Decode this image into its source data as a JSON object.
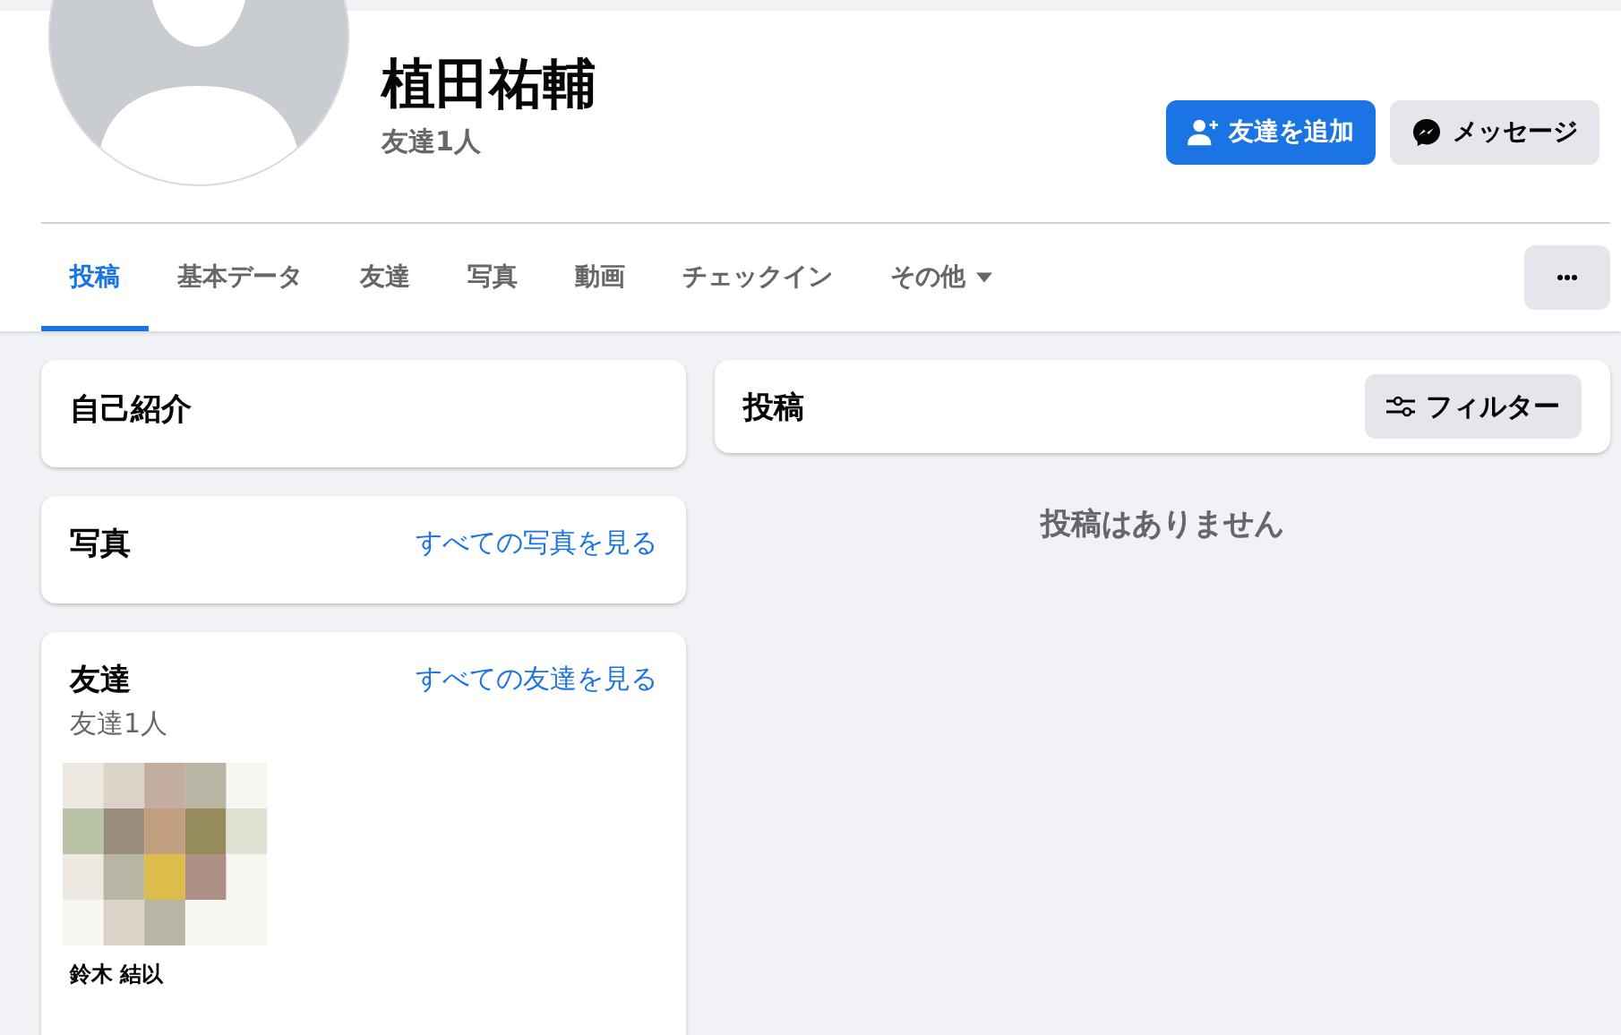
{
  "profile": {
    "name": "植田祐輔",
    "friend_count": "友達1人"
  },
  "actions": [
    {
      "kind": "primary",
      "label": "友達を追加"
    },
    {
      "kind": "secondary",
      "label": "メッセージ"
    }
  ],
  "tabs": [
    {
      "label": "投稿",
      "selected": true
    },
    {
      "label": "基本データ",
      "selected": false
    },
    {
      "label": "友達",
      "selected": false
    },
    {
      "label": "写真",
      "selected": false
    },
    {
      "label": "動画",
      "selected": false
    },
    {
      "label": "チェックイン",
      "selected": false
    },
    {
      "label": "その他",
      "selected": false,
      "dropdown": true
    }
  ],
  "intro": {
    "title": "自己紹介"
  },
  "photos": {
    "title": "写真",
    "link": "すべての写真を見る"
  },
  "friends": {
    "title": "友達",
    "link": "すべての友達を見る",
    "count": "友達1人",
    "items": [
      {
        "name": "鈴木 結以",
        "kind": "picture"
      }
    ]
  },
  "posts": {
    "title": "投稿",
    "filter": "フィルター",
    "empty": "投稿はありません"
  }
}
